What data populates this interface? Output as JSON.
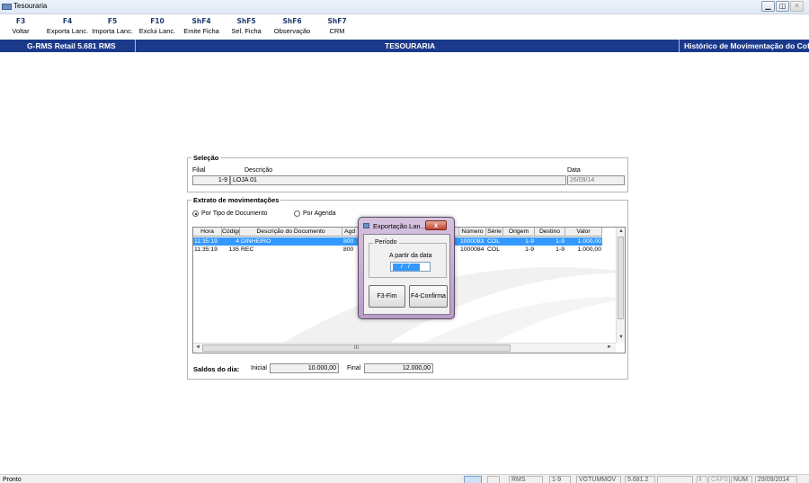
{
  "window": {
    "title": "Tesouraria"
  },
  "toolbar": [
    {
      "key": "F3",
      "label": "Voltar"
    },
    {
      "key": "F4",
      "label": "Exporta Lanc."
    },
    {
      "key": "F5",
      "label": "Importa Lanc."
    },
    {
      "key": "F10",
      "label": "Exclui Lanc."
    },
    {
      "key": "ShF4",
      "label": "Emite Ficha"
    },
    {
      "key": "ShF5",
      "label": "Sel. Ficha"
    },
    {
      "key": "ShF6",
      "label": "Observação"
    },
    {
      "key": "ShF7",
      "label": "CRM"
    }
  ],
  "header": {
    "left": "G-RMS Retail 5.681 RMS",
    "center": "TESOURARIA",
    "right": "Histórico de Movimentação do Cofr"
  },
  "selecao": {
    "title": "Seleção",
    "filial_label": "Filial",
    "descricao_label": "Descrição",
    "data_label": "Data",
    "filial_value": "1-9",
    "descricao_value": "LOJA 01",
    "data_value": "26/09/14"
  },
  "extrato": {
    "title": "Extrato de movimentações",
    "radio_tipo": "Por Tipo de Documento",
    "radio_agenda": "Por Agenda",
    "columns": [
      "Hora",
      "Código",
      "Descrição do Documento",
      "Agd",
      "Número",
      "Série",
      "Origem",
      "Destino",
      "Valor"
    ],
    "rows": [
      [
        "11:35:19",
        "4",
        "DINHEIRO",
        "800",
        "1000083",
        "COL",
        "1-9",
        "1-9",
        "1.000,00"
      ],
      [
        "11:35:19",
        "135",
        "REC",
        "800",
        "1000084",
        "COL",
        "1-9",
        "1-9",
        "1.000,00"
      ]
    ],
    "hscroll_label": "III"
  },
  "saldos": {
    "label": "Saldos do dia:",
    "inicial_label": "Inicial",
    "inicial_value": "10.000,00",
    "final_label": "Final",
    "final_value": "12.000,00"
  },
  "dialog": {
    "title": "Exportação Lan...",
    "close": "x",
    "group_title": "Período",
    "date_label": "A partir da data",
    "date_value": "/ /",
    "btn_fim": "F3-Fim",
    "btn_confirma": "F4-Confirma"
  },
  "status": {
    "left": "Pronto",
    "items": [
      "RMS",
      "1-9",
      "VGTUMMOV",
      "5.681.2",
      "",
      "I",
      "CAPS",
      "NUM",
      "29/09/2014"
    ]
  },
  "colors": {
    "header_blue": "#1b3a8c",
    "selection_blue": "#3399ff",
    "dialog_frame": "#c9b3d3"
  }
}
